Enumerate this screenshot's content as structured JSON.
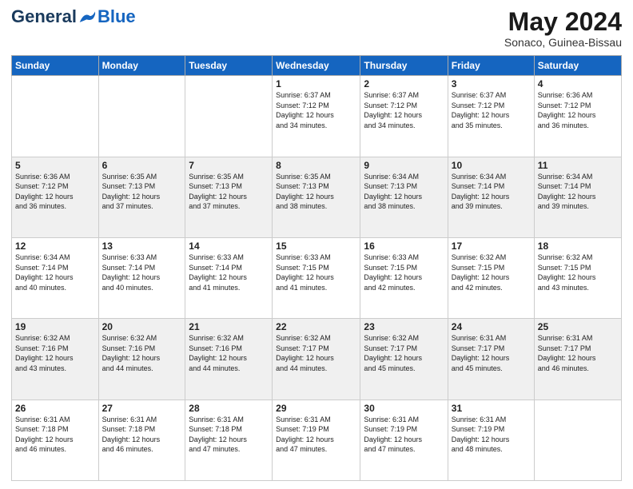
{
  "header": {
    "logo_general": "General",
    "logo_blue": "Blue",
    "month_year": "May 2024",
    "location": "Sonaco, Guinea-Bissau"
  },
  "days_of_week": [
    "Sunday",
    "Monday",
    "Tuesday",
    "Wednesday",
    "Thursday",
    "Friday",
    "Saturday"
  ],
  "weeks": [
    [
      {
        "num": "",
        "info": ""
      },
      {
        "num": "",
        "info": ""
      },
      {
        "num": "",
        "info": ""
      },
      {
        "num": "1",
        "info": "Sunrise: 6:37 AM\nSunset: 7:12 PM\nDaylight: 12 hours\nand 34 minutes."
      },
      {
        "num": "2",
        "info": "Sunrise: 6:37 AM\nSunset: 7:12 PM\nDaylight: 12 hours\nand 34 minutes."
      },
      {
        "num": "3",
        "info": "Sunrise: 6:37 AM\nSunset: 7:12 PM\nDaylight: 12 hours\nand 35 minutes."
      },
      {
        "num": "4",
        "info": "Sunrise: 6:36 AM\nSunset: 7:12 PM\nDaylight: 12 hours\nand 36 minutes."
      }
    ],
    [
      {
        "num": "5",
        "info": "Sunrise: 6:36 AM\nSunset: 7:12 PM\nDaylight: 12 hours\nand 36 minutes."
      },
      {
        "num": "6",
        "info": "Sunrise: 6:35 AM\nSunset: 7:13 PM\nDaylight: 12 hours\nand 37 minutes."
      },
      {
        "num": "7",
        "info": "Sunrise: 6:35 AM\nSunset: 7:13 PM\nDaylight: 12 hours\nand 37 minutes."
      },
      {
        "num": "8",
        "info": "Sunrise: 6:35 AM\nSunset: 7:13 PM\nDaylight: 12 hours\nand 38 minutes."
      },
      {
        "num": "9",
        "info": "Sunrise: 6:34 AM\nSunset: 7:13 PM\nDaylight: 12 hours\nand 38 minutes."
      },
      {
        "num": "10",
        "info": "Sunrise: 6:34 AM\nSunset: 7:14 PM\nDaylight: 12 hours\nand 39 minutes."
      },
      {
        "num": "11",
        "info": "Sunrise: 6:34 AM\nSunset: 7:14 PM\nDaylight: 12 hours\nand 39 minutes."
      }
    ],
    [
      {
        "num": "12",
        "info": "Sunrise: 6:34 AM\nSunset: 7:14 PM\nDaylight: 12 hours\nand 40 minutes."
      },
      {
        "num": "13",
        "info": "Sunrise: 6:33 AM\nSunset: 7:14 PM\nDaylight: 12 hours\nand 40 minutes."
      },
      {
        "num": "14",
        "info": "Sunrise: 6:33 AM\nSunset: 7:14 PM\nDaylight: 12 hours\nand 41 minutes."
      },
      {
        "num": "15",
        "info": "Sunrise: 6:33 AM\nSunset: 7:15 PM\nDaylight: 12 hours\nand 41 minutes."
      },
      {
        "num": "16",
        "info": "Sunrise: 6:33 AM\nSunset: 7:15 PM\nDaylight: 12 hours\nand 42 minutes."
      },
      {
        "num": "17",
        "info": "Sunrise: 6:32 AM\nSunset: 7:15 PM\nDaylight: 12 hours\nand 42 minutes."
      },
      {
        "num": "18",
        "info": "Sunrise: 6:32 AM\nSunset: 7:15 PM\nDaylight: 12 hours\nand 43 minutes."
      }
    ],
    [
      {
        "num": "19",
        "info": "Sunrise: 6:32 AM\nSunset: 7:16 PM\nDaylight: 12 hours\nand 43 minutes."
      },
      {
        "num": "20",
        "info": "Sunrise: 6:32 AM\nSunset: 7:16 PM\nDaylight: 12 hours\nand 44 minutes."
      },
      {
        "num": "21",
        "info": "Sunrise: 6:32 AM\nSunset: 7:16 PM\nDaylight: 12 hours\nand 44 minutes."
      },
      {
        "num": "22",
        "info": "Sunrise: 6:32 AM\nSunset: 7:17 PM\nDaylight: 12 hours\nand 44 minutes."
      },
      {
        "num": "23",
        "info": "Sunrise: 6:32 AM\nSunset: 7:17 PM\nDaylight: 12 hours\nand 45 minutes."
      },
      {
        "num": "24",
        "info": "Sunrise: 6:31 AM\nSunset: 7:17 PM\nDaylight: 12 hours\nand 45 minutes."
      },
      {
        "num": "25",
        "info": "Sunrise: 6:31 AM\nSunset: 7:17 PM\nDaylight: 12 hours\nand 46 minutes."
      }
    ],
    [
      {
        "num": "26",
        "info": "Sunrise: 6:31 AM\nSunset: 7:18 PM\nDaylight: 12 hours\nand 46 minutes."
      },
      {
        "num": "27",
        "info": "Sunrise: 6:31 AM\nSunset: 7:18 PM\nDaylight: 12 hours\nand 46 minutes."
      },
      {
        "num": "28",
        "info": "Sunrise: 6:31 AM\nSunset: 7:18 PM\nDaylight: 12 hours\nand 47 minutes."
      },
      {
        "num": "29",
        "info": "Sunrise: 6:31 AM\nSunset: 7:19 PM\nDaylight: 12 hours\nand 47 minutes."
      },
      {
        "num": "30",
        "info": "Sunrise: 6:31 AM\nSunset: 7:19 PM\nDaylight: 12 hours\nand 47 minutes."
      },
      {
        "num": "31",
        "info": "Sunrise: 6:31 AM\nSunset: 7:19 PM\nDaylight: 12 hours\nand 48 minutes."
      },
      {
        "num": "",
        "info": ""
      }
    ]
  ]
}
